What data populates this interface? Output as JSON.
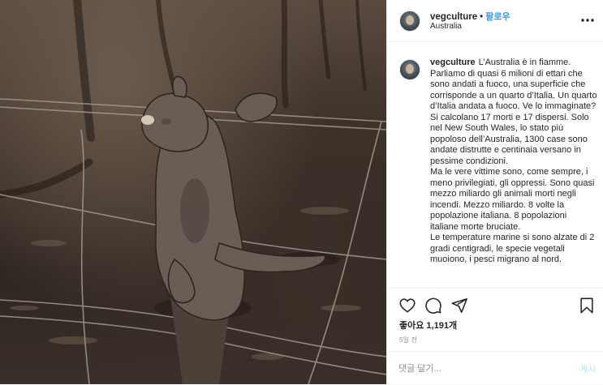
{
  "header": {
    "username": "vegculture",
    "separator": "•",
    "follow_label": "팔로우",
    "location": "Australia",
    "more_icon": "more-horizontal-icon"
  },
  "caption": {
    "username": "vegculture",
    "paragraphs": [
      "L’Australia è in fiamme. Parliamo di quasi 6 milioni di ettari che sono andati a fuoco, una superficie che corrisponde a un quarto d’Italia. Un quarto d’Italia andata a fuoco. Ve lo immaginate?",
      "Si calcolano 17 morti e 17 dispersi. Solo nel New South Wales, lo stato più popoloso dell’Australia, 1300 case sono andate distrutte e centinaia versano in pessime condizioni.",
      "Ma le vere vittime sono, come sempre, i meno privilegiati, gli oppressi. Sono quasi mezzo miliardo gli animali morti negli incendi. Mezzo miliardo. 8 volte la popolazione italiana. 8 popolazioni italiane morte bruciate.",
      "Le temperature marine si sono alzate di 2 gradi centigradi, le specie vegetali muoiono, i pesci migrano al nord."
    ]
  },
  "actions": {
    "like_icon": "heart-icon",
    "comment_icon": "comment-bubble-icon",
    "share_icon": "share-plane-icon",
    "bookmark_icon": "bookmark-icon",
    "likes_text": "좋아요 1,191개",
    "time_text": "5일 전"
  },
  "comment_form": {
    "placeholder": "댓글 달기...",
    "post_label": "게시"
  },
  "colors": {
    "accent": "#3897f0",
    "text": "#262626",
    "muted": "#8e8e8e",
    "disabled_post": "#b2dffc"
  }
}
